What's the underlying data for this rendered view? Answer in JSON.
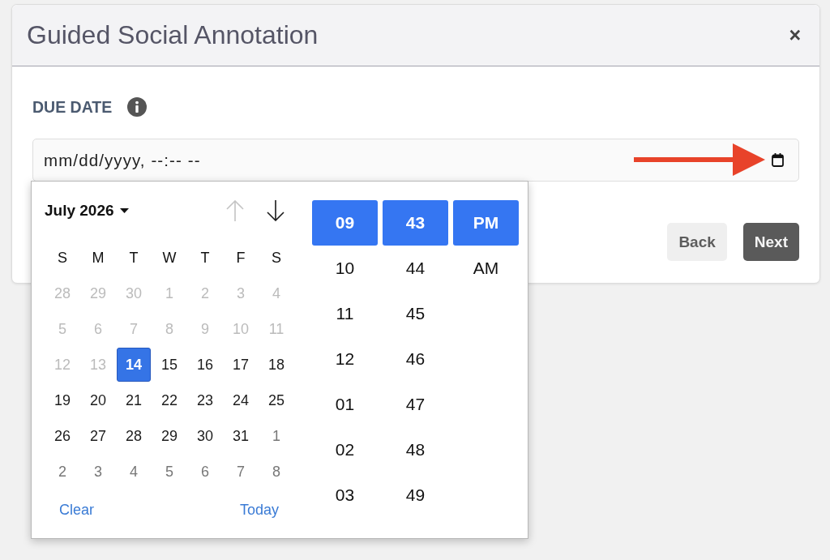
{
  "dialog": {
    "title": "Guided Social Annotation",
    "close": "×"
  },
  "due_date": {
    "label": "DUE DATE",
    "placeholder": "mm/dd/yyyy, --:-- --"
  },
  "picker": {
    "month": "July 2026",
    "nav": [
      {
        "kind": "up",
        "disabled": true
      },
      {
        "kind": "down",
        "disabled": false
      }
    ],
    "weekdays": [
      "S",
      "M",
      "T",
      "W",
      "T",
      "F",
      "S"
    ],
    "weeks": [
      {
        "days": [
          {
            "label": "28",
            "kind": "disabled",
            "selected": false
          },
          {
            "label": "29",
            "kind": "disabled",
            "selected": false
          },
          {
            "label": "30",
            "kind": "disabled",
            "selected": false
          },
          {
            "label": "1",
            "kind": "disabled",
            "selected": false
          },
          {
            "label": "2",
            "kind": "disabled",
            "selected": false
          },
          {
            "label": "3",
            "kind": "disabled",
            "selected": false
          },
          {
            "label": "4",
            "kind": "disabled",
            "selected": false
          }
        ]
      },
      {
        "days": [
          {
            "label": "5",
            "kind": "disabled",
            "selected": false
          },
          {
            "label": "6",
            "kind": "disabled",
            "selected": false
          },
          {
            "label": "7",
            "kind": "disabled",
            "selected": false
          },
          {
            "label": "8",
            "kind": "disabled",
            "selected": false
          },
          {
            "label": "9",
            "kind": "disabled",
            "selected": false
          },
          {
            "label": "10",
            "kind": "disabled",
            "selected": false
          },
          {
            "label": "11",
            "kind": "disabled",
            "selected": false
          }
        ]
      },
      {
        "days": [
          {
            "label": "12",
            "kind": "disabled",
            "selected": false
          },
          {
            "label": "13",
            "kind": "disabled",
            "selected": false
          },
          {
            "label": "14",
            "kind": "current",
            "selected": true
          },
          {
            "label": "15",
            "kind": "current",
            "selected": false
          },
          {
            "label": "16",
            "kind": "current",
            "selected": false
          },
          {
            "label": "17",
            "kind": "current",
            "selected": false
          },
          {
            "label": "18",
            "kind": "current",
            "selected": false
          }
        ]
      },
      {
        "days": [
          {
            "label": "19",
            "kind": "current",
            "selected": false
          },
          {
            "label": "20",
            "kind": "current",
            "selected": false
          },
          {
            "label": "21",
            "kind": "current",
            "selected": false
          },
          {
            "label": "22",
            "kind": "current",
            "selected": false
          },
          {
            "label": "23",
            "kind": "current",
            "selected": false
          },
          {
            "label": "24",
            "kind": "current",
            "selected": false
          },
          {
            "label": "25",
            "kind": "current",
            "selected": false
          }
        ]
      },
      {
        "days": [
          {
            "label": "26",
            "kind": "current",
            "selected": false
          },
          {
            "label": "27",
            "kind": "current",
            "selected": false
          },
          {
            "label": "28",
            "kind": "current",
            "selected": false
          },
          {
            "label": "29",
            "kind": "current",
            "selected": false
          },
          {
            "label": "30",
            "kind": "current",
            "selected": false
          },
          {
            "label": "31",
            "kind": "current",
            "selected": false
          },
          {
            "label": "1",
            "kind": "other",
            "selected": false
          }
        ]
      },
      {
        "days": [
          {
            "label": "2",
            "kind": "other",
            "selected": false
          },
          {
            "label": "3",
            "kind": "other",
            "selected": false
          },
          {
            "label": "4",
            "kind": "other",
            "selected": false
          },
          {
            "label": "5",
            "kind": "other",
            "selected": false
          },
          {
            "label": "6",
            "kind": "other",
            "selected": false
          },
          {
            "label": "7",
            "kind": "other",
            "selected": false
          },
          {
            "label": "8",
            "kind": "other",
            "selected": false
          }
        ]
      }
    ],
    "actions": [
      {
        "label": "Clear"
      },
      {
        "label": "Today"
      }
    ],
    "time_columns": [
      {
        "items": [
          {
            "label": "09",
            "selected": true
          },
          {
            "label": "10",
            "selected": false
          },
          {
            "label": "11",
            "selected": false
          },
          {
            "label": "12",
            "selected": false
          },
          {
            "label": "01",
            "selected": false
          },
          {
            "label": "02",
            "selected": false
          },
          {
            "label": "03",
            "selected": false
          }
        ]
      },
      {
        "items": [
          {
            "label": "43",
            "selected": true
          },
          {
            "label": "44",
            "selected": false
          },
          {
            "label": "45",
            "selected": false
          },
          {
            "label": "46",
            "selected": false
          },
          {
            "label": "47",
            "selected": false
          },
          {
            "label": "48",
            "selected": false
          },
          {
            "label": "49",
            "selected": false
          }
        ]
      },
      {
        "items": [
          {
            "label": "PM",
            "selected": true
          },
          {
            "label": "AM",
            "selected": false
          }
        ]
      }
    ]
  },
  "buttons": [
    {
      "label": "Back",
      "kind": "secondary"
    },
    {
      "label": "Next",
      "kind": "primary"
    }
  ]
}
